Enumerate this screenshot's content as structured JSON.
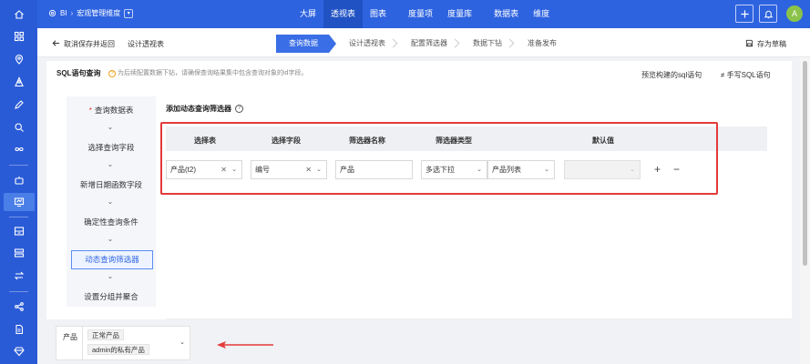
{
  "colors": {
    "rail": "#2a5bd7",
    "topbar": "#2e63e0",
    "accent": "#3a6ee6",
    "highlight_red": "#e33a3a"
  },
  "rail": {
    "items": [
      "home-icon",
      "grid-icon",
      "location-icon",
      "person-icon",
      "pen-icon",
      "search-icon",
      "infinity-icon",
      "robot-icon",
      "monitor-icon",
      "archive-icon",
      "inbox-icon",
      "swap-icon",
      "share-icon",
      "document-icon",
      "diamond-icon"
    ],
    "active": "monitor-icon"
  },
  "topbar": {
    "crumb_home": "BI",
    "crumb_sep": "›",
    "crumb_current": "宏观管理维度",
    "nav": [
      "大屏",
      "透视表",
      "图表",
      "度量项",
      "度量库",
      "数据表",
      "维度"
    ],
    "nav_active": "透视表",
    "avatar_letter": "A"
  },
  "subbar": {
    "back_label": "取消保存并返回",
    "title": "设计透视表",
    "steps": [
      "查询数据",
      "设计透视表",
      "配置筛选器",
      "数据下钻",
      "准备发布"
    ],
    "save_draft": "存为草稿"
  },
  "panel": {
    "sql_title": "SQL语句查询",
    "sql_hint": "为后续配置数据下钻，请确保查询结果集中包含查询对象的id字段。",
    "preview_sql": "预览构建的sql语句",
    "hand_sql_icon": "≠",
    "hand_sql": "手写SQL语句",
    "vertical_steps": [
      "查询数据表",
      "选择查询字段",
      "新增日期函数字段",
      "确定性查询条件",
      "动态查询筛选器",
      "设置分组并聚合"
    ],
    "required_mark": "*",
    "active_step": "动态查询筛选器",
    "filter_title": "添加动态查询筛选器",
    "columns": [
      "选择表",
      "选择字段",
      "筛选器名称",
      "筛选器类型",
      "默认值"
    ],
    "row": {
      "table": "产品(t2)",
      "field": "编号",
      "name": "产品",
      "type": "多选下拉",
      "source": "产品列表",
      "default": ""
    },
    "add_symbol": "+",
    "remove_symbol": "−"
  },
  "demo": {
    "label": "产品",
    "tags": [
      "正常产品",
      "admin的私有产品"
    ]
  }
}
